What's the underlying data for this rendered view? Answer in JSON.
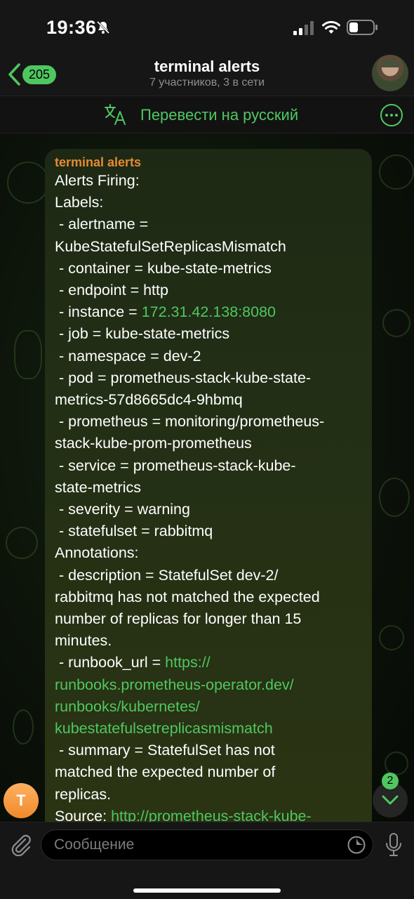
{
  "status_bar": {
    "time": "19:36"
  },
  "header": {
    "back_badge": "205",
    "title": "terminal alerts",
    "subtitle": "7 участников, 3 в сети"
  },
  "translate_bar": {
    "label": "Перевести на русский"
  },
  "message": {
    "sender": "terminal alerts",
    "lines": [
      {
        "text": "Alerts Firing:"
      },
      {
        "text": "Labels:"
      },
      {
        "text": " - alertname ="
      },
      {
        "text": "KubeStatefulSetReplicasMismatch"
      },
      {
        "text": " - container = kube-state-metrics"
      },
      {
        "text": " - endpoint = http"
      },
      {
        "text": " - instance = ",
        "link": "172.31.42.138:8080"
      },
      {
        "text": " - job = kube-state-metrics"
      },
      {
        "text": " - namespace = dev-2"
      },
      {
        "text": " - pod = prometheus-stack-kube-state-"
      },
      {
        "text": "metrics-57d8665dc4-9hbmq"
      },
      {
        "text": " - prometheus = monitoring/prometheus-"
      },
      {
        "text": "stack-kube-prom-prometheus"
      },
      {
        "text": " - service = prometheus-stack-kube-"
      },
      {
        "text": "state-metrics"
      },
      {
        "text": " - severity = warning"
      },
      {
        "text": " - statefulset = rabbitmq"
      },
      {
        "text": "Annotations:"
      },
      {
        "text": " - description = StatefulSet dev-2/"
      },
      {
        "text": "rabbitmq has not matched the expected"
      },
      {
        "text": "number of replicas for longer than 15"
      },
      {
        "text": "minutes."
      },
      {
        "text": " - runbook_url = ",
        "link": "https://"
      },
      {
        "text": "",
        "link": "runbooks.prometheus-operator.dev/"
      },
      {
        "text": "",
        "link": "runbooks/kubernetes/"
      },
      {
        "text": "",
        "link": "kubestatefulsetreplicasmismatch"
      },
      {
        "text": " - summary = StatefulSet has not"
      },
      {
        "text": "matched the expected number of"
      },
      {
        "text": "replicas."
      },
      {
        "text": "Source: ",
        "link": "http://prometheus-stack-kube-"
      }
    ]
  },
  "sender_avatar": {
    "initial": "T",
    "color": "#f39a3d"
  },
  "scroll_down": {
    "badge": "2"
  },
  "input": {
    "placeholder": "Сообщение"
  },
  "colors": {
    "accent": "#4fc760",
    "sender": "#e48b32"
  }
}
